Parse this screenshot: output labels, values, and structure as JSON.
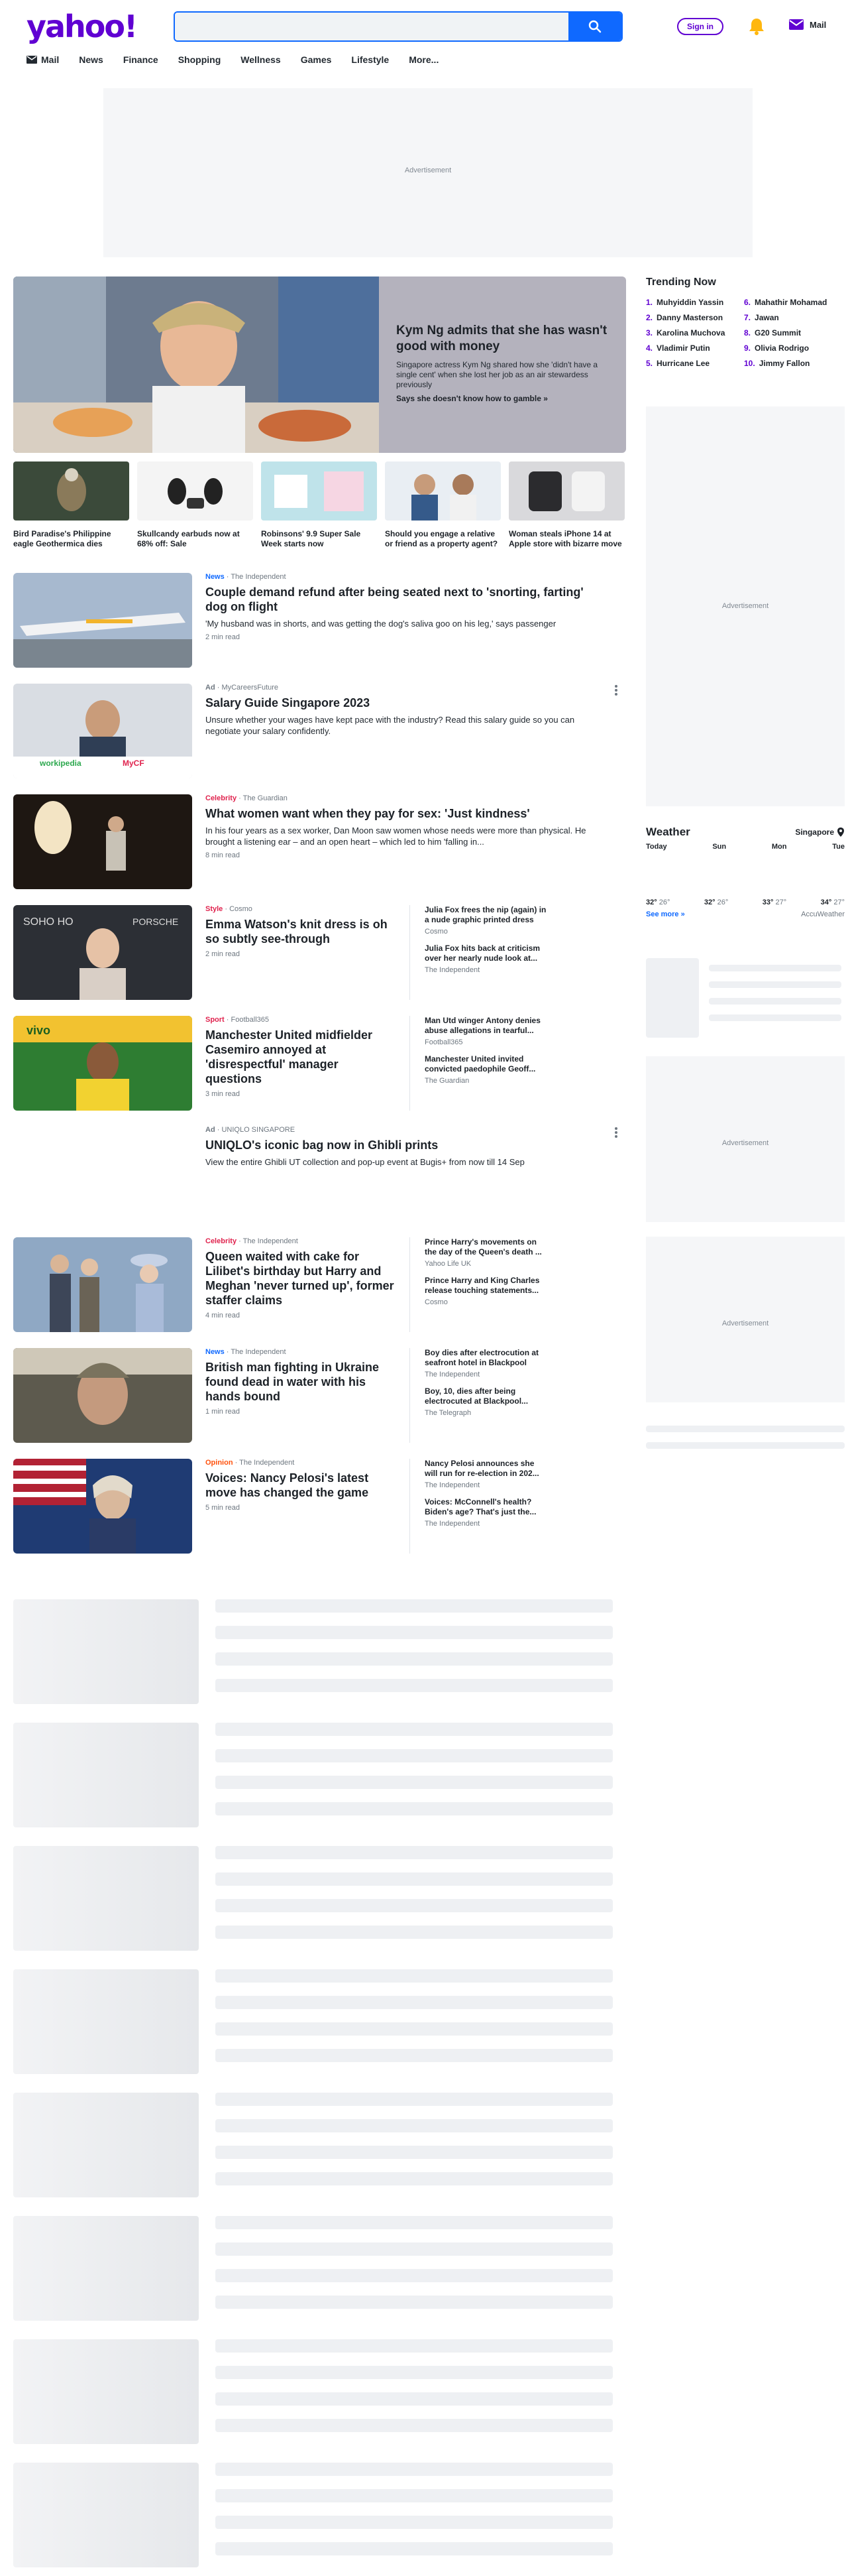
{
  "header": {
    "logo": "yahoo!",
    "search": {
      "value": "",
      "placeholder": ""
    },
    "signin_label": "Sign in",
    "mail_label": "Mail",
    "nav": [
      {
        "label": "Mail",
        "icon": "mail-icon"
      },
      {
        "label": "News"
      },
      {
        "label": "Finance"
      },
      {
        "label": "Shopping"
      },
      {
        "label": "Wellness"
      },
      {
        "label": "Games"
      },
      {
        "label": "Lifestyle"
      },
      {
        "label": "More..."
      }
    ]
  },
  "ads": {
    "label": "Advertisement"
  },
  "hero": {
    "title": "Kym Ng admits that she has wasn't good with money",
    "summary": "Singapore actress Kym Ng shared how she 'didn't have a single cent' when she lost her job as an air stewardess previously",
    "link": "Says she doesn't know how to gamble »"
  },
  "thumbs": [
    {
      "title": "Bird Paradise's Philippine eagle Geothermica dies"
    },
    {
      "title": "Skullcandy earbuds now at 68% off: Sale"
    },
    {
      "title": "Robinsons' 9.9 Super Sale Week starts now"
    },
    {
      "title": "Should you engage a relative or friend as a property agent?"
    },
    {
      "title": "Woman steals iPhone 14 at Apple store with bizarre move"
    }
  ],
  "stories": [
    {
      "category": "News",
      "cat_color": "#0f69ff",
      "source": "The Independent",
      "title": "Couple demand refund after being seated next to 'snorting, farting' dog on flight",
      "summary": "'My husband was in shorts, and was getting the dog's saliva goo on his leg,' says passenger",
      "read": "2 min read"
    },
    {
      "category": "Ad",
      "cat_color": "#6e7780",
      "source": "MyCareersFuture",
      "title": "Salary Guide Singapore 2023",
      "summary": "Unsure whether your wages have kept pace with the industry? Read this salary guide so you can negotiate your salary confidently.",
      "read": "",
      "logo_a": "workipedia",
      "logo_b": "MyCF"
    },
    {
      "category": "Celebrity",
      "cat_color": "#e0234e",
      "source": "The Guardian",
      "title": "What women want when they pay for sex: 'Just kindness'",
      "summary": "In his four years as a sex worker, Dan Moon saw women whose needs were more than physical. He brought a listening ear – and an open heart – which led to him 'falling in...",
      "read": "8 min read"
    },
    {
      "category": "Style",
      "cat_color": "#e0234e",
      "source": "Cosmo",
      "title": "Emma Watson's knit dress is oh so subtly see-through",
      "summary": "",
      "read": "2 min read",
      "related": [
        {
          "title": "Julia Fox frees the nip (again) in a nude graphic printed dress",
          "source": "Cosmo"
        },
        {
          "title": "Julia Fox hits back at criticism over her nearly nude look at...",
          "source": "The Independent"
        }
      ]
    },
    {
      "category": "Sport",
      "cat_color": "#e0234e",
      "source": "Football365",
      "title": "Manchester United midfielder Casemiro annoyed at 'disrespectful' manager questions",
      "summary": "",
      "read": "3 min read",
      "related": [
        {
          "title": "Man Utd winger Antony denies abuse allegations in tearful...",
          "source": "Football365"
        },
        {
          "title": "Manchester United invited convicted paedophile Geoff...",
          "source": "The Guardian"
        }
      ]
    },
    {
      "category": "Ad",
      "cat_color": "#6e7780",
      "source": "UNIQLO SINGAPORE",
      "title": "UNIQLO's iconic bag now in Ghibli prints",
      "summary": "View the entire Ghibli UT collection and pop-up event at Bugis+ from now till 14 Sep",
      "read": ""
    },
    {
      "category": "Celebrity",
      "cat_color": "#e0234e",
      "source": "The Independent",
      "title": "Queen waited with cake for Lilibet's birthday but Harry and Meghan 'never turned up', former staffer claims",
      "summary": "",
      "read": "4 min read",
      "related": [
        {
          "title": "Prince Harry's movements on the day of the Queen's death ...",
          "source": "Yahoo Life UK"
        },
        {
          "title": "Prince Harry and King Charles release touching statements...",
          "source": "Cosmo"
        }
      ]
    },
    {
      "category": "News",
      "cat_color": "#0f69ff",
      "source": "The Independent",
      "title": "British man fighting in Ukraine found dead in water with his hands bound",
      "summary": "",
      "read": "1 min read",
      "related": [
        {
          "title": "Boy dies after electrocution at seafront hotel in Blackpool",
          "source": "The Independent"
        },
        {
          "title": "Boy, 10, dies after being electrocuted at Blackpool...",
          "source": "The Telegraph"
        }
      ]
    },
    {
      "category": "Opinion",
      "cat_color": "#ff520d",
      "source": "The Independent",
      "title": "Voices: Nancy Pelosi's latest move has changed the game",
      "summary": "",
      "read": "5 min read",
      "related": [
        {
          "title": "Nancy Pelosi announces she will run for re-election in 202...",
          "source": "The Independent"
        },
        {
          "title": "Voices: McConnell's health? Biden's age? That's just the...",
          "source": "The Independent"
        }
      ]
    }
  ],
  "trending": {
    "title": "Trending Now",
    "items": [
      {
        "n": "1.",
        "label": "Muhyiddin Yassin"
      },
      {
        "n": "6.",
        "label": "Mahathir Mohamad"
      },
      {
        "n": "2.",
        "label": "Danny Masterson"
      },
      {
        "n": "7.",
        "label": "Jawan"
      },
      {
        "n": "3.",
        "label": "Karolina Muchova"
      },
      {
        "n": "8.",
        "label": "G20 Summit"
      },
      {
        "n": "4.",
        "label": "Vladimir Putin"
      },
      {
        "n": "9.",
        "label": "Olivia Rodrigo"
      },
      {
        "n": "5.",
        "label": "Hurricane Lee"
      },
      {
        "n": "10.",
        "label": "Jimmy Fallon"
      }
    ]
  },
  "weather": {
    "title": "Weather",
    "location": "Singapore",
    "days": [
      "Today",
      "Sun",
      "Mon",
      "Tue"
    ],
    "temps": [
      {
        "hi": "32°",
        "lo": "26°"
      },
      {
        "hi": "32°",
        "lo": "26°"
      },
      {
        "hi": "33°",
        "lo": "27°"
      },
      {
        "hi": "34°",
        "lo": "27°"
      }
    ],
    "see_more": "See more »",
    "provider": "AccuWeather"
  }
}
